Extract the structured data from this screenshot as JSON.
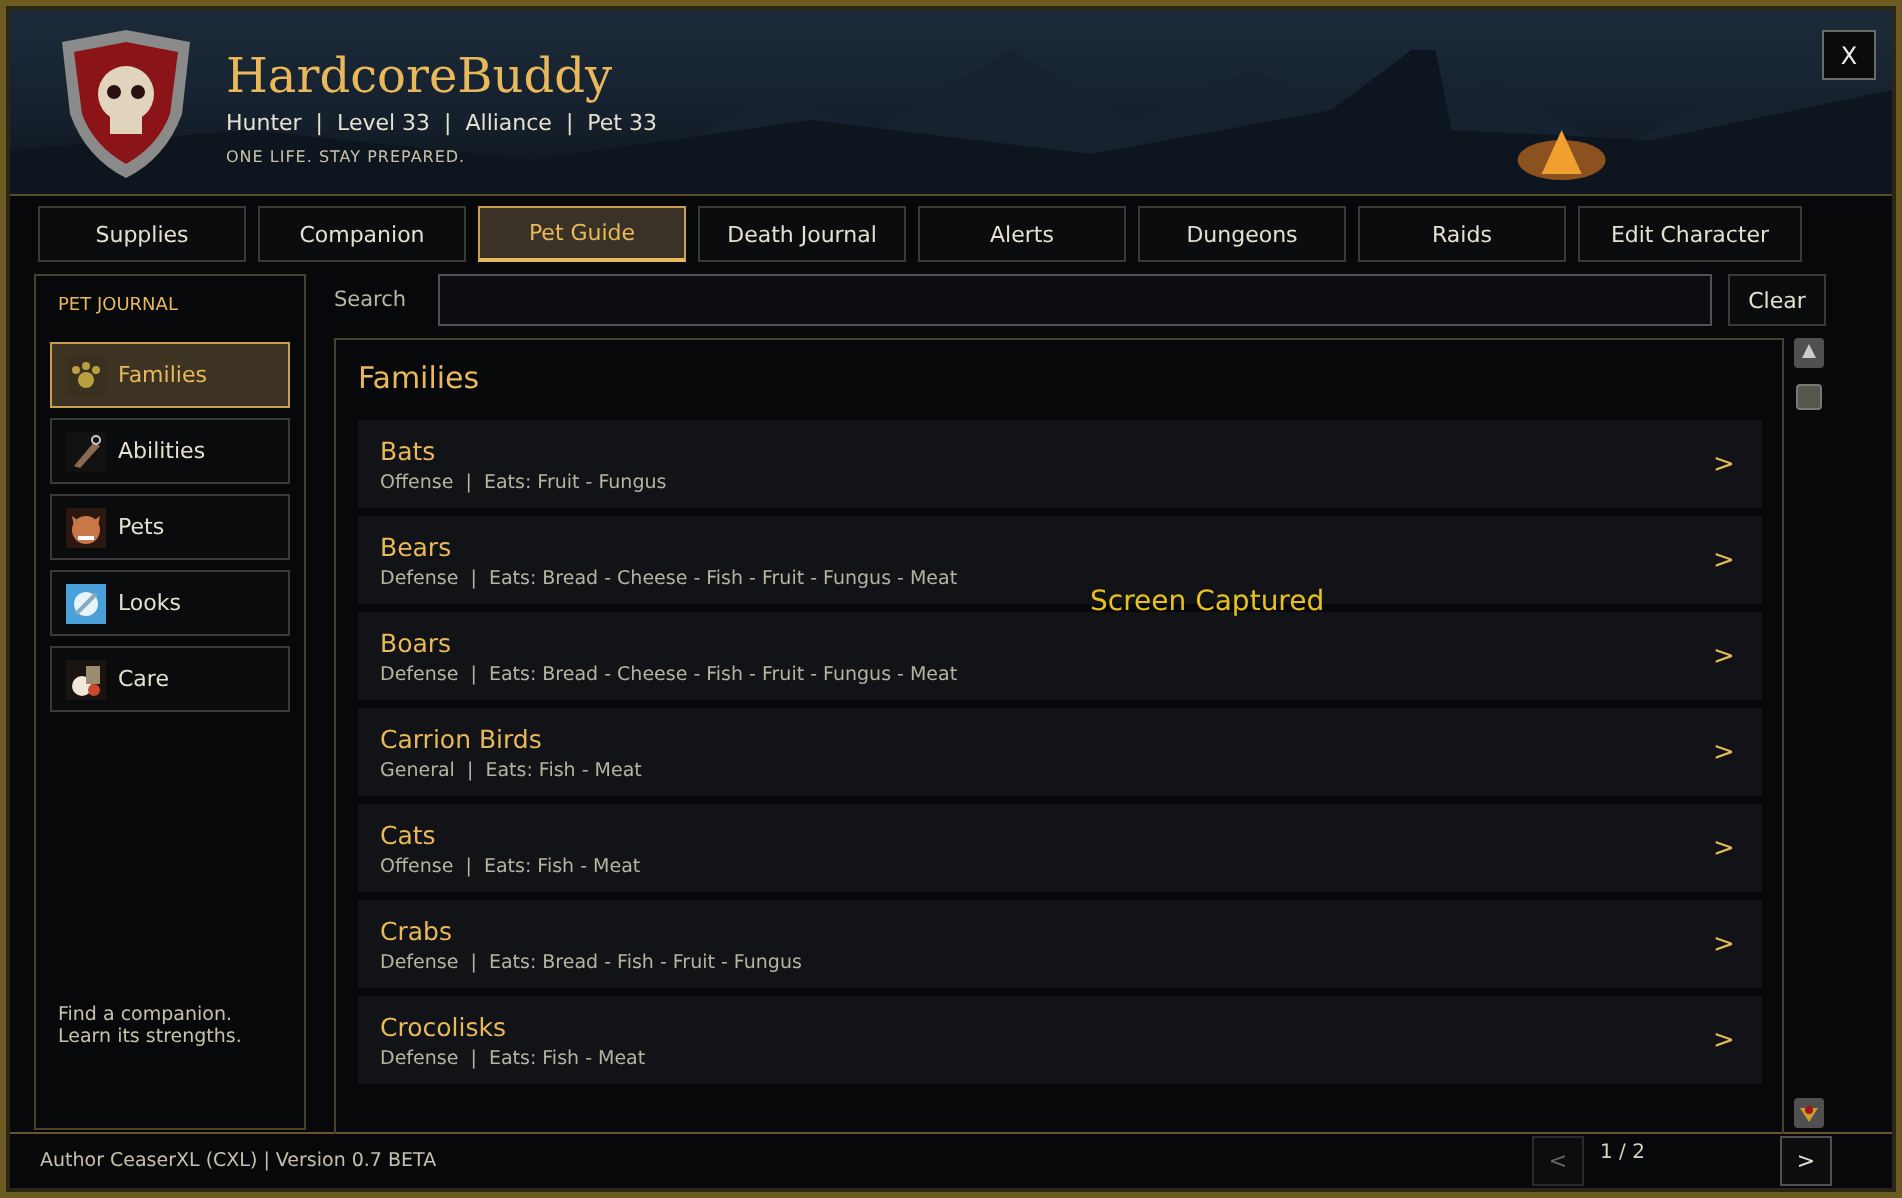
{
  "window": {
    "title": "HardcoreBuddy",
    "subtitle": "Hunter  |  Level 33  |  Alliance  |  Pet 33",
    "tagline": "ONE LIFE. STAY PREPARED.",
    "close": "X"
  },
  "tabs": [
    {
      "label": "Supplies",
      "selected": false
    },
    {
      "label": "Companion",
      "selected": false
    },
    {
      "label": "Pet Guide",
      "selected": true
    },
    {
      "label": "Death Journal",
      "selected": false
    },
    {
      "label": "Alerts",
      "selected": false
    },
    {
      "label": "Dungeons",
      "selected": false
    },
    {
      "label": "Raids",
      "selected": false
    },
    {
      "label": "Edit Character",
      "selected": false
    }
  ],
  "sidebar": {
    "heading": "PET JOURNAL",
    "items": [
      {
        "label": "Families",
        "selected": true
      },
      {
        "label": "Abilities",
        "selected": false
      },
      {
        "label": "Pets",
        "selected": false
      },
      {
        "label": "Looks",
        "selected": false
      },
      {
        "label": "Care",
        "selected": false
      }
    ],
    "note": "Find a companion.\nLearn its strengths."
  },
  "search": {
    "label": "Search",
    "button": "Clear"
  },
  "content": {
    "title": "Families",
    "rows": [
      {
        "name": "Bats",
        "detail": "Offense  |  Eats: Fruit - Fungus",
        "arrow": ">"
      },
      {
        "name": "Bears",
        "detail": "Defense  |  Eats: Bread - Cheese - Fish - Fruit - Fungus - Meat",
        "arrow": ">"
      },
      {
        "name": "Boars",
        "detail": "Defense  |  Eats: Bread - Cheese - Fish - Fruit - Fungus - Meat",
        "arrow": ">"
      },
      {
        "name": "Carrion Birds",
        "detail": "General  |  Eats: Fish - Meat",
        "arrow": ">"
      },
      {
        "name": "Cats",
        "detail": "Offense  |  Eats: Fish - Meat",
        "arrow": ">"
      },
      {
        "name": "Crabs",
        "detail": "Defense  |  Eats: Bread - Fish - Fruit - Fungus",
        "arrow": ">"
      },
      {
        "name": "Crocolisks",
        "detail": "Defense  |  Eats: Fish - Meat",
        "arrow": ">"
      }
    ]
  },
  "toast": "Screen Captured",
  "footer": {
    "credit": "Author CeaserXL (CXL) | Version 0.7 BETA",
    "pager": {
      "prev": "<",
      "prev_disabled": true,
      "page": "1 / 2",
      "next": ">"
    }
  }
}
